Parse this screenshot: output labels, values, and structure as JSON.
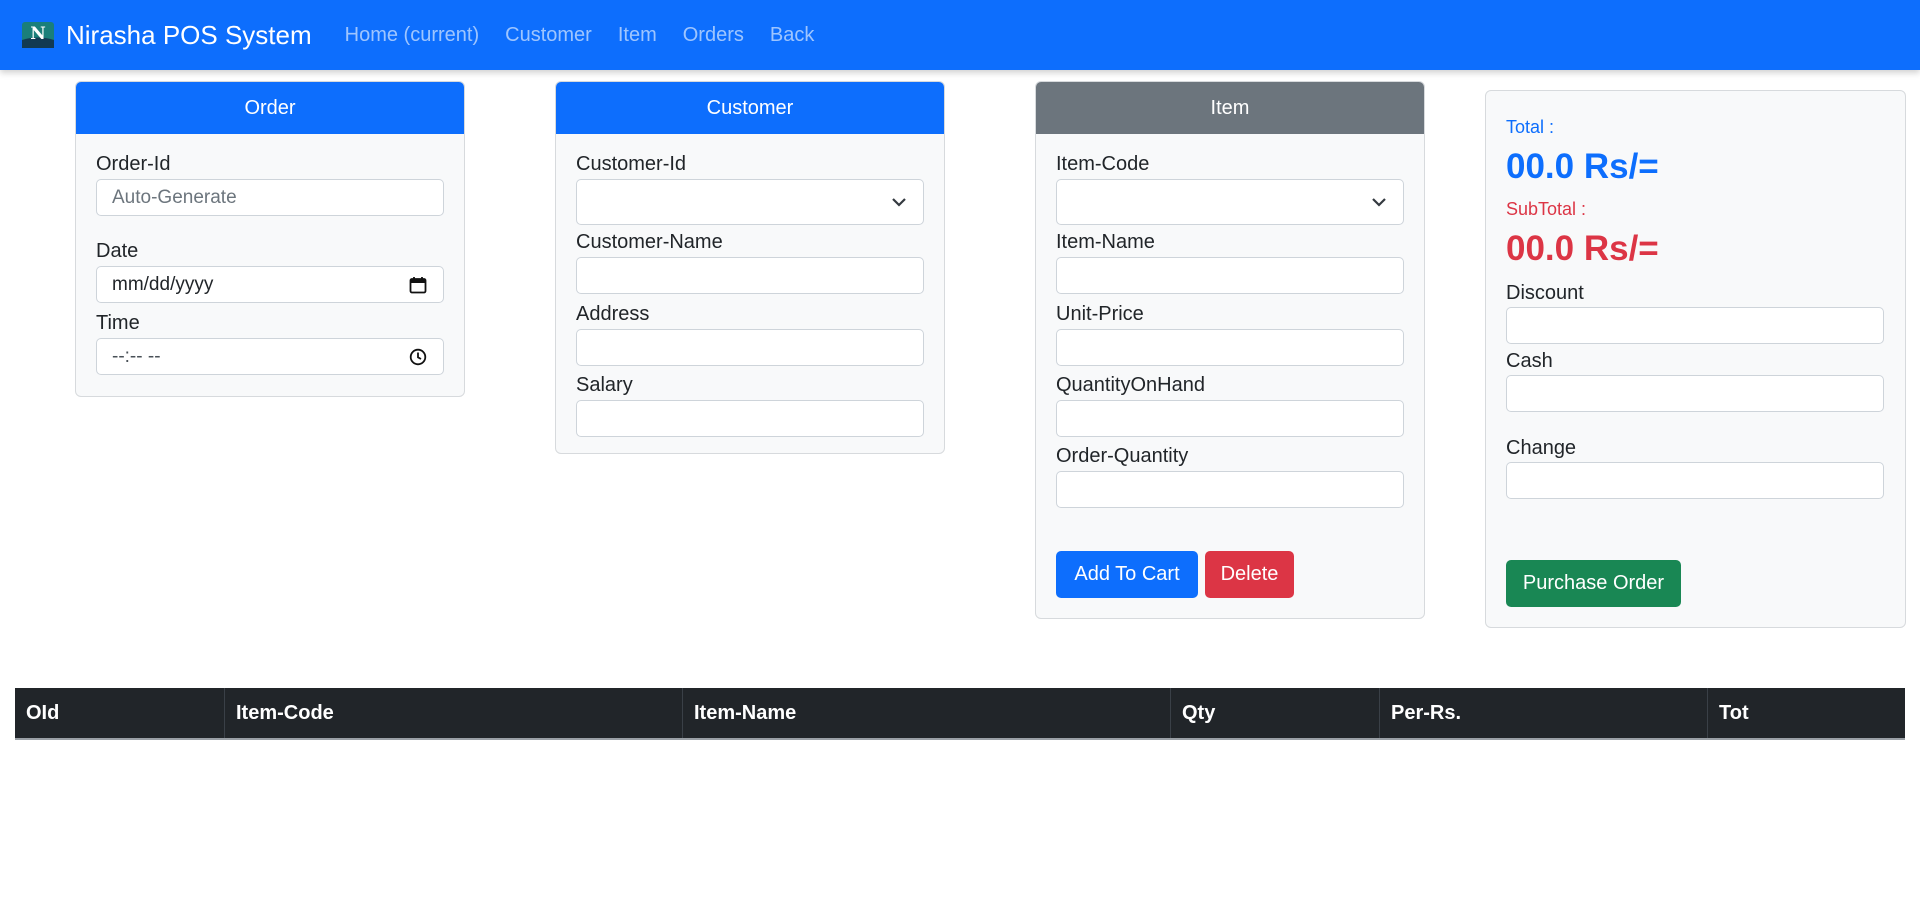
{
  "navbar": {
    "brand": "Nirasha POS System",
    "brand_icon": "netscape-n-logo",
    "links": [
      "Home (current)",
      "Customer",
      "Item",
      "Orders",
      "Back"
    ],
    "background": "#0d6efd"
  },
  "order": {
    "header": "Order",
    "order_id_label": "Order-Id",
    "order_id_placeholder": "Auto-Generate",
    "date_label": "Date",
    "date_value": "mm/dd/yyyy",
    "time_label": "Time",
    "time_value": "--:-- --"
  },
  "customer": {
    "header": "Customer",
    "id_label": "Customer-Id",
    "id_value": "",
    "name_label": "Customer-Name",
    "address_label": "Address",
    "salary_label": "Salary"
  },
  "item": {
    "header": "Item",
    "code_label": "Item-Code",
    "code_value": "",
    "name_label": "Item-Name",
    "unit_price_label": "Unit-Price",
    "qoh_label": "QuantityOnHand",
    "order_qty_label": "Order-Quantity",
    "add_button": "Add To Cart",
    "delete_button": "Delete"
  },
  "totals": {
    "total_label": "Total :",
    "total_value": "00.0 Rs/=",
    "subtotal_label": "SubTotal :",
    "subtotal_value": "00.0 Rs/=",
    "discount_label": "Discount",
    "cash_label": "Cash",
    "change_label": "Change",
    "purchase_button": "Purchase Order"
  },
  "table": {
    "columns": [
      "OId",
      "Item-Code",
      "Item-Name",
      "Qty",
      "Per-Rs.",
      "Tot"
    ],
    "rows": []
  },
  "colors": {
    "primary": "#0d6efd",
    "secondary": "#6c757d",
    "danger": "#dc3545",
    "success": "#198754",
    "dark": "#212529"
  }
}
